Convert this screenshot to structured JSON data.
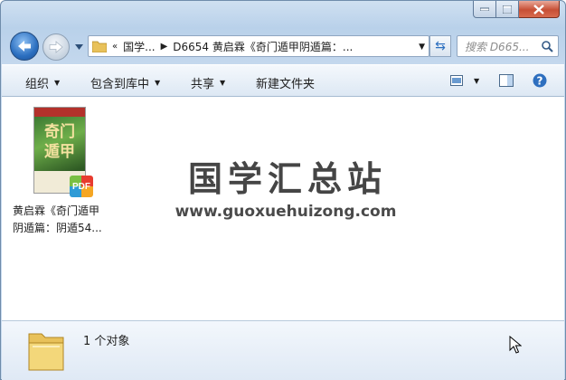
{
  "nav": {
    "breadcrumbs": [
      "«",
      "国学...",
      "D6654 黄启霖《奇门遁甲阴遁篇：..."
    ],
    "search_placeholder": "搜索 D665..."
  },
  "toolbar": {
    "organize": "组织",
    "include_in_library": "包含到库中",
    "share": "共享",
    "new_folder": "新建文件夹"
  },
  "file": {
    "name": "黄启霖《奇门遁甲\n阴遁篇：阴遁54...",
    "badge": "PDF",
    "cover_text": "奇门遁甲"
  },
  "watermark": {
    "title": "国学汇总站",
    "url": "www.guoxuehuizong.com"
  },
  "details": {
    "count_text": "1 个对象"
  },
  "icons": [
    "back-arrow-icon",
    "forward-arrow-icon",
    "folder-icon",
    "refresh-icon",
    "search-icon",
    "view-icon",
    "preview-pane-icon",
    "help-icon",
    "minimize-icon",
    "maximize-icon",
    "close-icon",
    "cursor-icon"
  ]
}
